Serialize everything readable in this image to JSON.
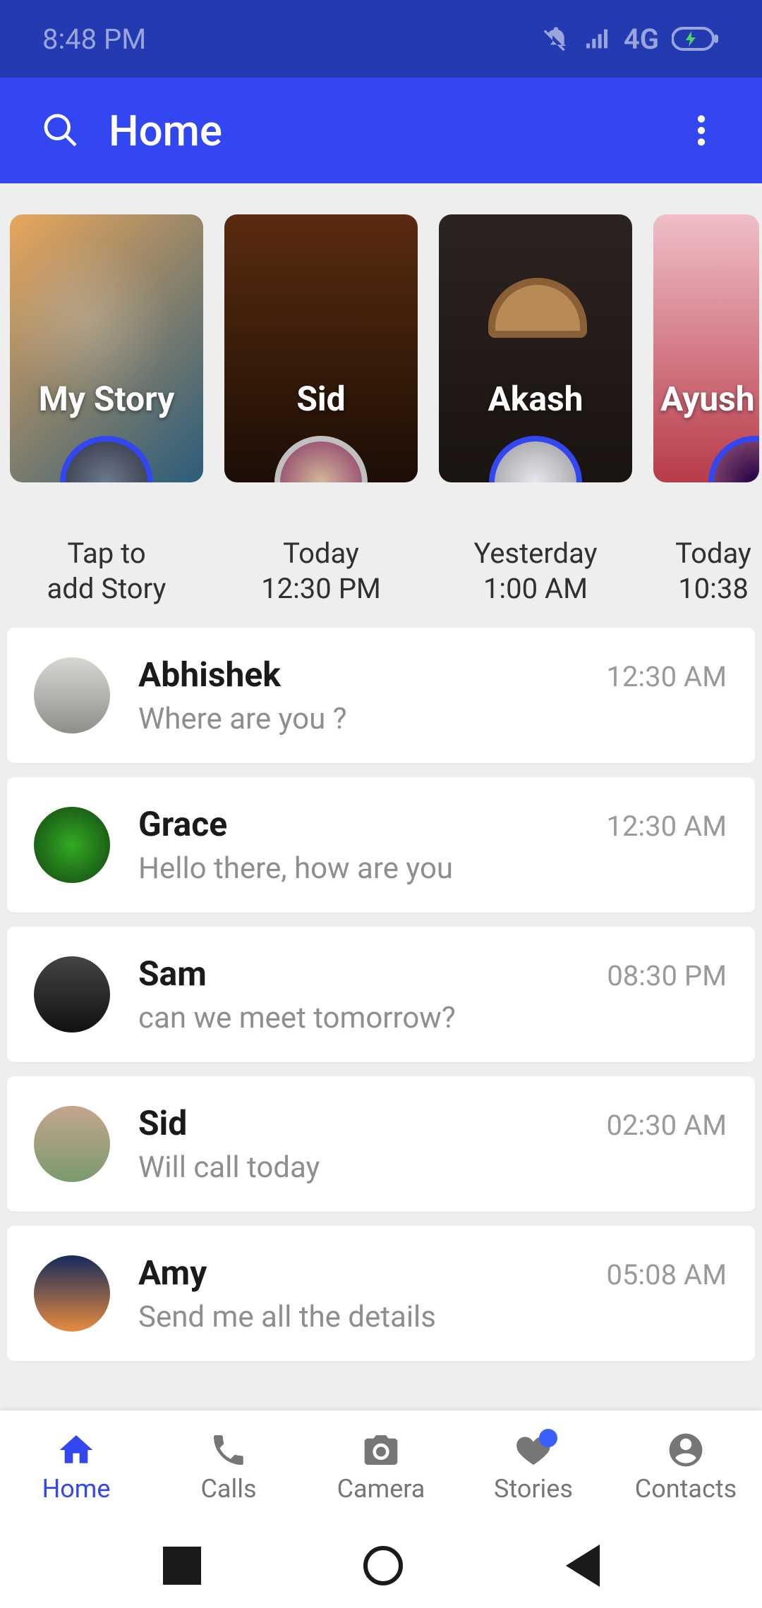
{
  "status_bar": {
    "time": "8:48 PM",
    "network": "4G"
  },
  "toolbar": {
    "title": "Home"
  },
  "stories": [
    {
      "label": "My Story",
      "caption_l1": "Tap to",
      "caption_l2": "add Story",
      "ring": true
    },
    {
      "label": "Sid",
      "caption_l1": "Today",
      "caption_l2": "12:30 PM",
      "ring": false
    },
    {
      "label": "Akash",
      "caption_l1": "Yesterday",
      "caption_l2": "1:00 AM",
      "ring": true
    },
    {
      "label": "Ayush",
      "caption_l1": "Today",
      "caption_l2": "10:38",
      "ring": true
    }
  ],
  "chats": [
    {
      "name": "Abhishek",
      "msg": "Where are you ?",
      "time": "12:30 AM"
    },
    {
      "name": "Grace",
      "msg": "Hello there, how are you",
      "time": "12:30 AM"
    },
    {
      "name": "Sam",
      "msg": "can we meet tomorrow?",
      "time": "08:30 PM"
    },
    {
      "name": "Sid",
      "msg": "Will call today",
      "time": "02:30 AM"
    },
    {
      "name": "Amy",
      "msg": "Send me all the details",
      "time": "05:08 AM"
    }
  ],
  "bottom_nav": {
    "home": "Home",
    "calls": "Calls",
    "camera": "Camera",
    "stories": "Stories",
    "contacts": "Contacts"
  }
}
